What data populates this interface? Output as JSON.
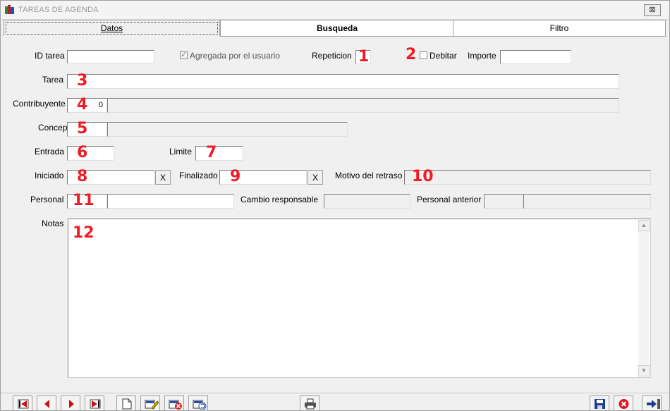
{
  "window": {
    "title": "TAREAS DE AGENDA",
    "close_label": "⊠"
  },
  "tabs": [
    {
      "label": "Datos"
    },
    {
      "label": "Busqueda"
    },
    {
      "label": "Filtro"
    }
  ],
  "form": {
    "id_tarea": {
      "label": "ID tarea",
      "value": ""
    },
    "agregada": {
      "label": "Agregada por el usuario",
      "checked": true
    },
    "repeticion": {
      "label": "Repeticion",
      "value": ""
    },
    "debitar": {
      "label": "Debitar",
      "checked": false
    },
    "importe": {
      "label": "Importe",
      "value": ""
    },
    "tarea": {
      "label": "Tarea",
      "value": ""
    },
    "contribuyente": {
      "label": "Contribuyente",
      "code": "0",
      "name": ""
    },
    "concepto": {
      "label": "Concepto",
      "code": "",
      "name": ""
    },
    "entrada": {
      "label": "Entrada",
      "value": ""
    },
    "limite": {
      "label": "Limite",
      "value": ""
    },
    "iniciado": {
      "label": "Iniciado",
      "value": "",
      "clear": "X"
    },
    "finalizado": {
      "label": "Finalizado",
      "value": "",
      "clear": "X"
    },
    "motivo": {
      "label": "Motivo del retraso",
      "value": ""
    },
    "personal": {
      "label": "Personal",
      "code": "",
      "name": ""
    },
    "cambio": {
      "label": "Cambio responsable",
      "value": ""
    },
    "personal_anterior": {
      "label": "Personal anterior",
      "code": "",
      "name": ""
    },
    "notas": {
      "label": "Notas",
      "value": ""
    }
  },
  "markers": [
    "1",
    "2",
    "3",
    "4",
    "5",
    "6",
    "7",
    "8",
    "9",
    "10",
    "11",
    "12"
  ],
  "toolbar": {
    "buttons": [
      "first-record-icon",
      "previous-record-icon",
      "next-record-icon",
      "last-record-icon",
      "new-record-icon",
      "edit-record-icon",
      "delete-record-icon",
      "undo-record-icon",
      "print-icon",
      "save-icon",
      "cancel-icon",
      "exit-icon"
    ]
  },
  "colors": {
    "marker": "#ee1c25",
    "save": "#1a3d8f",
    "cancel": "#d71920",
    "nav_arrow": "#cc1111"
  }
}
